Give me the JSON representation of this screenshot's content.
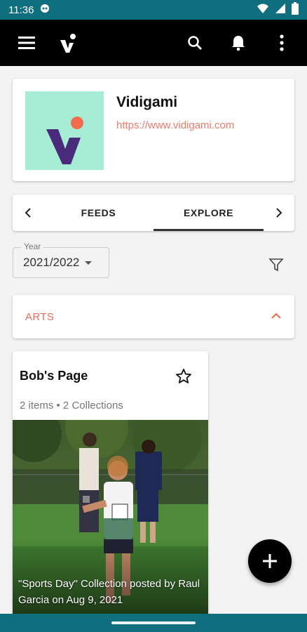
{
  "status_bar": {
    "time": "11:36",
    "icons": [
      "notification-icon",
      "wifi-icon",
      "signal-icon",
      "battery-icon"
    ]
  },
  "app_bar": {
    "icons": [
      "menu-icon",
      "vidigami-logo",
      "search-icon",
      "bell-icon",
      "more-vert-icon"
    ]
  },
  "profile": {
    "name": "Vidigami",
    "url": "https://www.vidigami.com",
    "logo_colors": {
      "background": "#a7ecd5",
      "v": "#4a2a7a",
      "dot": "#f26b4f"
    }
  },
  "tabs": {
    "items": [
      {
        "label": "FEEDS",
        "active": false
      },
      {
        "label": "EXPLORE",
        "active": true
      }
    ]
  },
  "filter": {
    "year_label": "Year",
    "year_value": "2021/2022"
  },
  "category": {
    "label": "ARTS",
    "expanded": true
  },
  "page_card": {
    "title": "Bob's Page",
    "meta": "2 items • 2 Collections",
    "caption": "\"Sports Day\" Collection posted by Raul Garcia on Aug 9, 2021"
  },
  "colors": {
    "status_bar": "#0f6f7f",
    "app_bar": "#000000",
    "accent": "#ef6b5a",
    "url": "#ef7b6a"
  }
}
